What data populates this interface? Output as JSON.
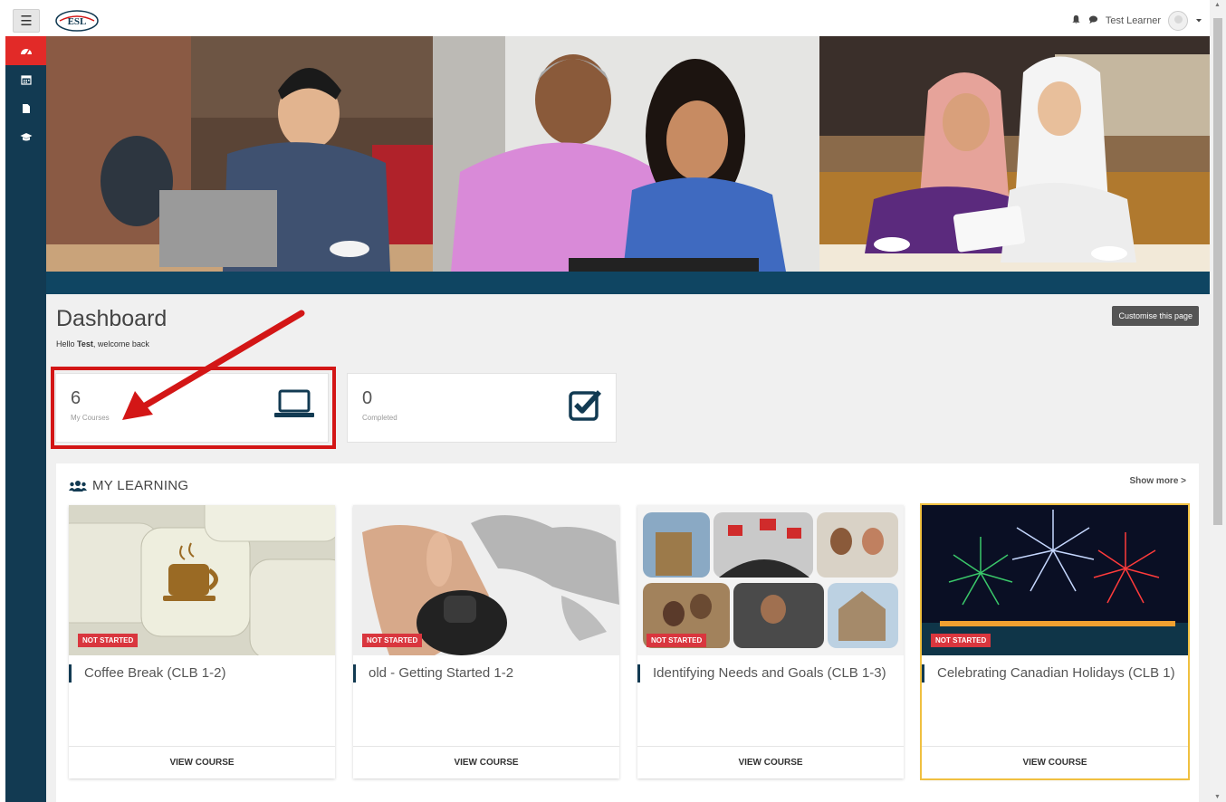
{
  "header": {
    "logo_text": "ESL",
    "user_name": "Test Learner"
  },
  "sidebar": {
    "items": [
      {
        "icon": "dashboard-icon",
        "active": true
      },
      {
        "icon": "calendar-icon",
        "active": false
      },
      {
        "icon": "file-icon",
        "active": false
      },
      {
        "icon": "graduation-cap-icon",
        "active": false
      }
    ]
  },
  "page": {
    "title": "Dashboard",
    "greeting_prefix": "Hello ",
    "greeting_name": "Test",
    "greeting_suffix": ", welcome back",
    "customise_label": "Customise this page"
  },
  "stats": [
    {
      "value": "6",
      "label": "My Courses",
      "icon": "laptop-icon"
    },
    {
      "value": "0",
      "label": "Completed",
      "icon": "checkbox-icon"
    }
  ],
  "learning": {
    "title": "MY LEARNING",
    "show_more": "Show more >",
    "courses": [
      {
        "title": "Coffee Break (CLB 1-2)",
        "status": "NOT STARTED",
        "button": "VIEW COURSE"
      },
      {
        "title": "old - Getting Started 1-2",
        "status": "NOT STARTED",
        "button": "VIEW COURSE"
      },
      {
        "title": "Identifying Needs and Goals (CLB 1-3)",
        "status": "NOT STARTED",
        "button": "VIEW COURSE"
      },
      {
        "title": "Celebrating Canadian Holidays (CLB 1)",
        "status": "NOT STARTED",
        "button": "VIEW COURSE"
      }
    ]
  },
  "colors": {
    "sidebar": "#123a52",
    "active": "#e22a28",
    "band": "#0f4562",
    "badge": "#d9363e",
    "annotation": "#d31616"
  }
}
